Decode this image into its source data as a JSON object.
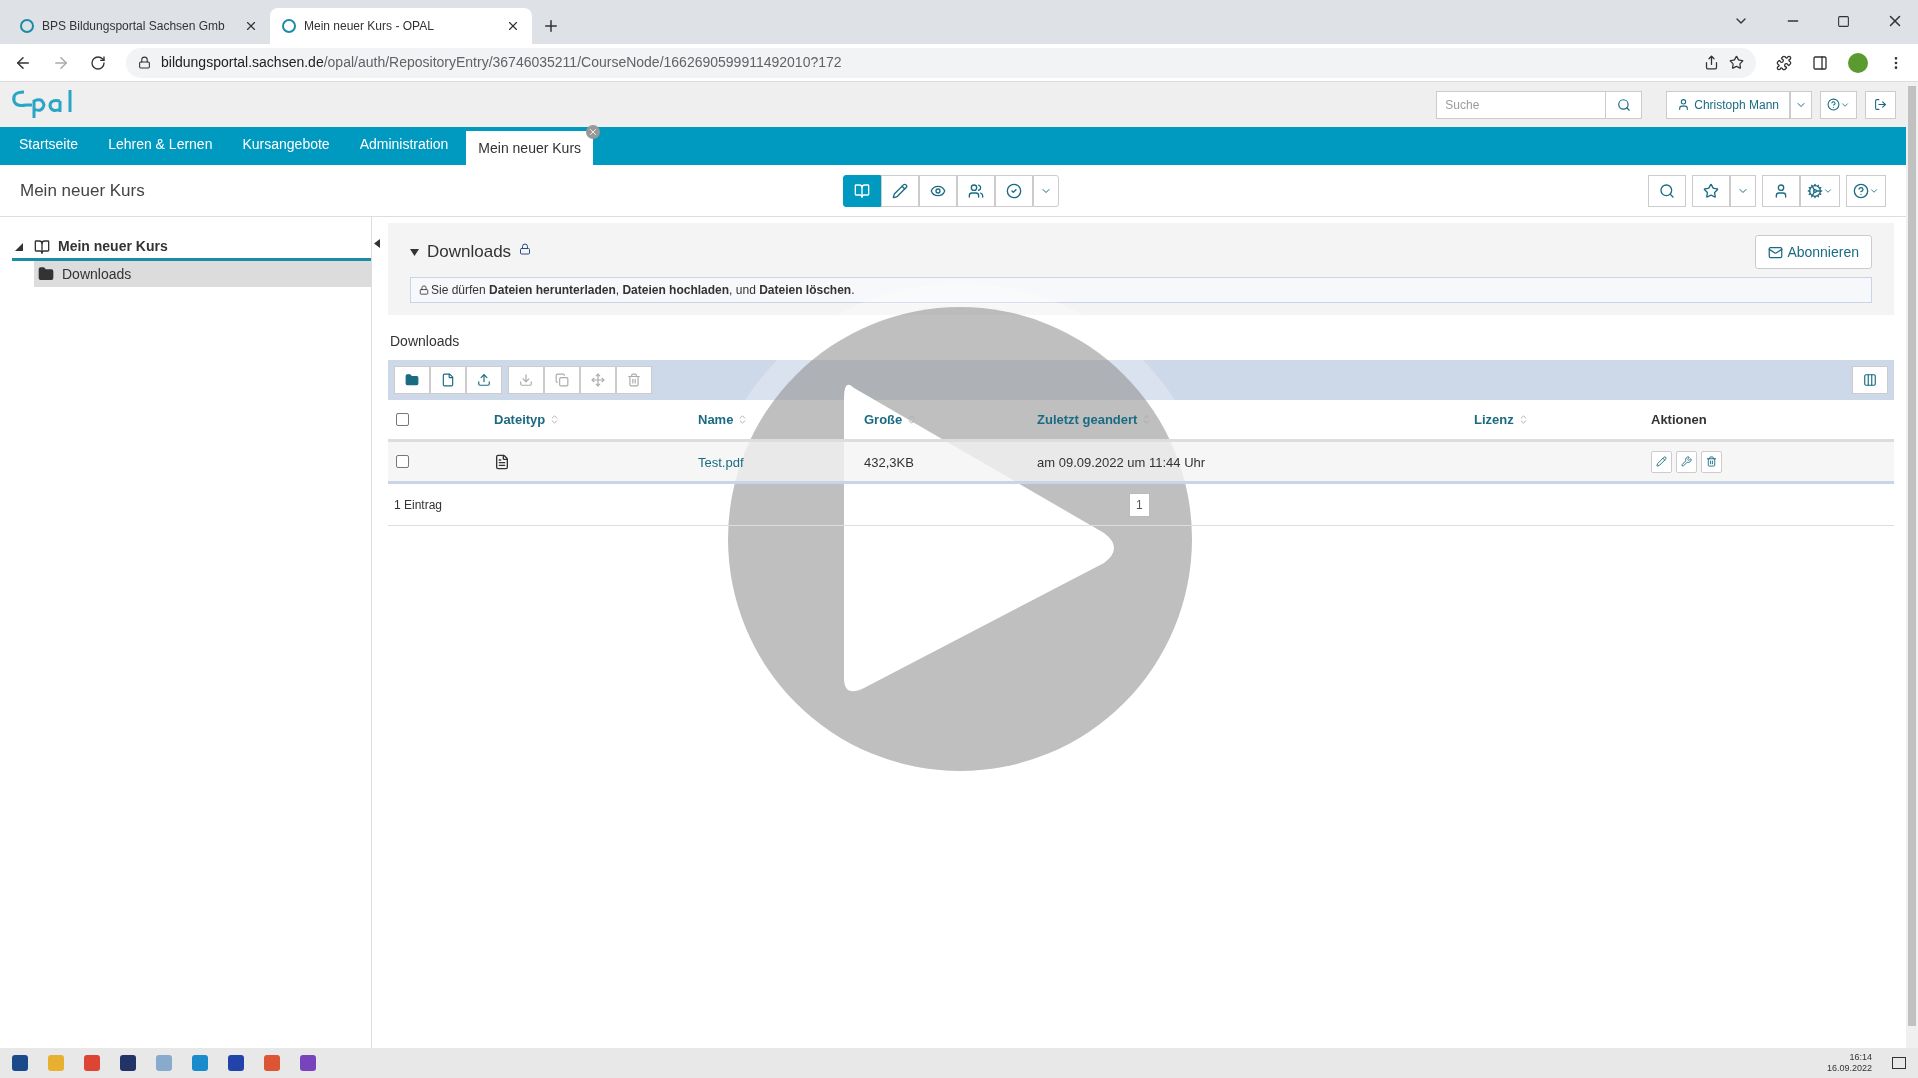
{
  "browser_tabs": [
    {
      "title": "BPS Bildungsportal Sachsen Gmb",
      "selected": false
    },
    {
      "title": "Mein neuer Kurs - OPAL",
      "selected": true
    }
  ],
  "url": {
    "domain": "bildungsportal.sachsen.de",
    "path": "/opal/auth/RepositoryEntry/36746035211/CourseNode/1662690599911492010?172"
  },
  "header": {
    "search_placeholder": "Suche",
    "user": "Christoph Mann"
  },
  "nav": [
    {
      "label": "Startseite",
      "selected": false
    },
    {
      "label": "Lehren & Lernen",
      "selected": false
    },
    {
      "label": "Kursangebote",
      "selected": false
    },
    {
      "label": "Administration",
      "selected": false
    },
    {
      "label": "Mein neuer Kurs",
      "selected": true
    }
  ],
  "course_title": "Mein neuer Kurs",
  "tree": {
    "label": "Mein neuer Kurs",
    "expanded": true,
    "children": [
      {
        "label": "Downloads",
        "selected": true
      }
    ]
  },
  "node": {
    "title": "Downloads",
    "expanded": true,
    "subscribe": "Abonnieren",
    "permission": "Sie dürfen **Dateien herunterladen**, **Dateien hochladen**, und **Dateien löschen**."
  },
  "folder": {
    "title": "Downloads",
    "columns": [
      {
        "label": "Dateityp",
        "sortable": true
      },
      {
        "label": "Name",
        "sortable": true
      },
      {
        "label": "Große",
        "sortable": true
      },
      {
        "label": "Zuletzt geandert",
        "sortable": true
      },
      {
        "label": "Lizenz",
        "sortable": true
      },
      {
        "label": "Aktionen",
        "sortable": false
      }
    ],
    "rows": [
      {
        "checked": false,
        "name": "Test.pdf",
        "size": "432,3KB",
        "modified": "am 09.09.2022 um 11:44 Uhr"
      }
    ],
    "all_checked": false,
    "count": "1 Eintrag",
    "page": "1"
  },
  "taskbar": {
    "time": "16:14",
    "date": "16.09.2022"
  }
}
